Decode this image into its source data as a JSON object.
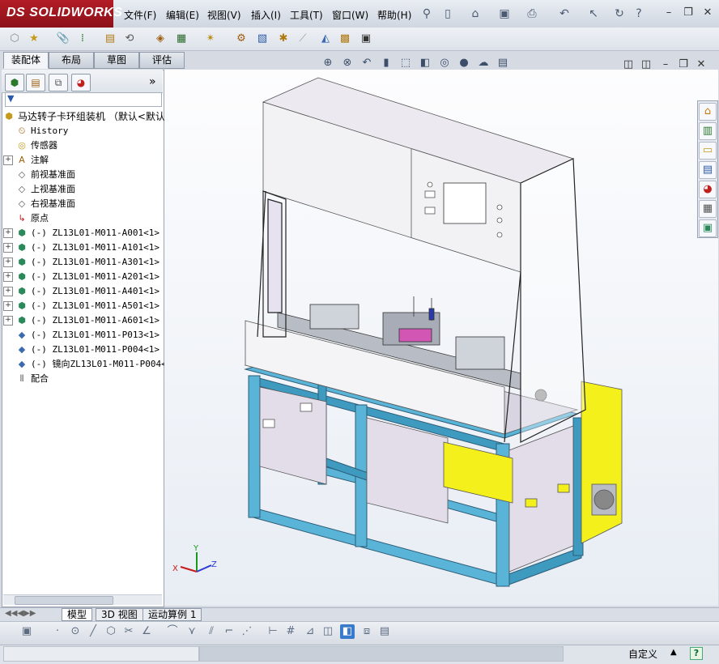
{
  "app": {
    "logo_text": "SOLIDWORKS",
    "logo_prefix": "DS"
  },
  "menu": [
    "文件(F)",
    "编辑(E)",
    "视图(V)",
    "插入(I)",
    "工具(T)",
    "窗口(W)",
    "帮助(H)"
  ],
  "command_tabs": [
    "装配体",
    "布局",
    "草图",
    "评估"
  ],
  "panel_more": "»",
  "tree": {
    "root": "马达转子卡环组装机  （默认<默认",
    "items": [
      {
        "label": "History",
        "icon": "history-icon",
        "expandable": false
      },
      {
        "label": "传感器",
        "icon": "sensor-icon",
        "expandable": false
      },
      {
        "label": "注解",
        "icon": "annotation-icon",
        "expandable": true
      },
      {
        "label": "前视基准面",
        "icon": "plane-icon",
        "expandable": false
      },
      {
        "label": "上视基准面",
        "icon": "plane-icon",
        "expandable": false
      },
      {
        "label": "右视基准面",
        "icon": "plane-icon",
        "expandable": false
      },
      {
        "label": "原点",
        "icon": "origin-icon",
        "expandable": false
      },
      {
        "label": "(-) ZL13L01-M011-A001<1> (",
        "icon": "assembly-icon",
        "expandable": true
      },
      {
        "label": "(-) ZL13L01-M011-A101<1> (",
        "icon": "assembly-icon",
        "expandable": true
      },
      {
        "label": "(-) ZL13L01-M011-A301<1> (",
        "icon": "assembly-icon",
        "expandable": true
      },
      {
        "label": "(-) ZL13L01-M011-A201<1> (",
        "icon": "assembly-icon",
        "expandable": true
      },
      {
        "label": "(-) ZL13L01-M011-A401<1> (",
        "icon": "assembly-icon",
        "expandable": true
      },
      {
        "label": "(-) ZL13L01-M011-A501<1> (",
        "icon": "assembly-icon",
        "expandable": true
      },
      {
        "label": "(-) ZL13L01-M011-A601<1> (",
        "icon": "assembly-icon",
        "expandable": true
      },
      {
        "label": "(-) ZL13L01-M011-P013<1> (",
        "icon": "part-icon",
        "expandable": false
      },
      {
        "label": "(-) ZL13L01-M011-P004<1> (",
        "icon": "part-icon",
        "expandable": false
      },
      {
        "label": "(-) 镜向ZL13L01-M011-P004<",
        "icon": "part-icon",
        "expandable": false
      },
      {
        "label": "配合",
        "icon": "mates-icon",
        "expandable": false
      }
    ]
  },
  "model_tabs": [
    "模型",
    "3D 视图",
    "运动算例 1"
  ],
  "status": {
    "custom": "自定义",
    "help": "?"
  },
  "triad": {
    "x": "X",
    "y": "Y",
    "z": "Z"
  },
  "colors": {
    "frame_blue": "#5ab4d8",
    "yellow_box": "#f3f01c",
    "panel_gray": "#e2dde8",
    "brand_red": "#b31c26"
  }
}
